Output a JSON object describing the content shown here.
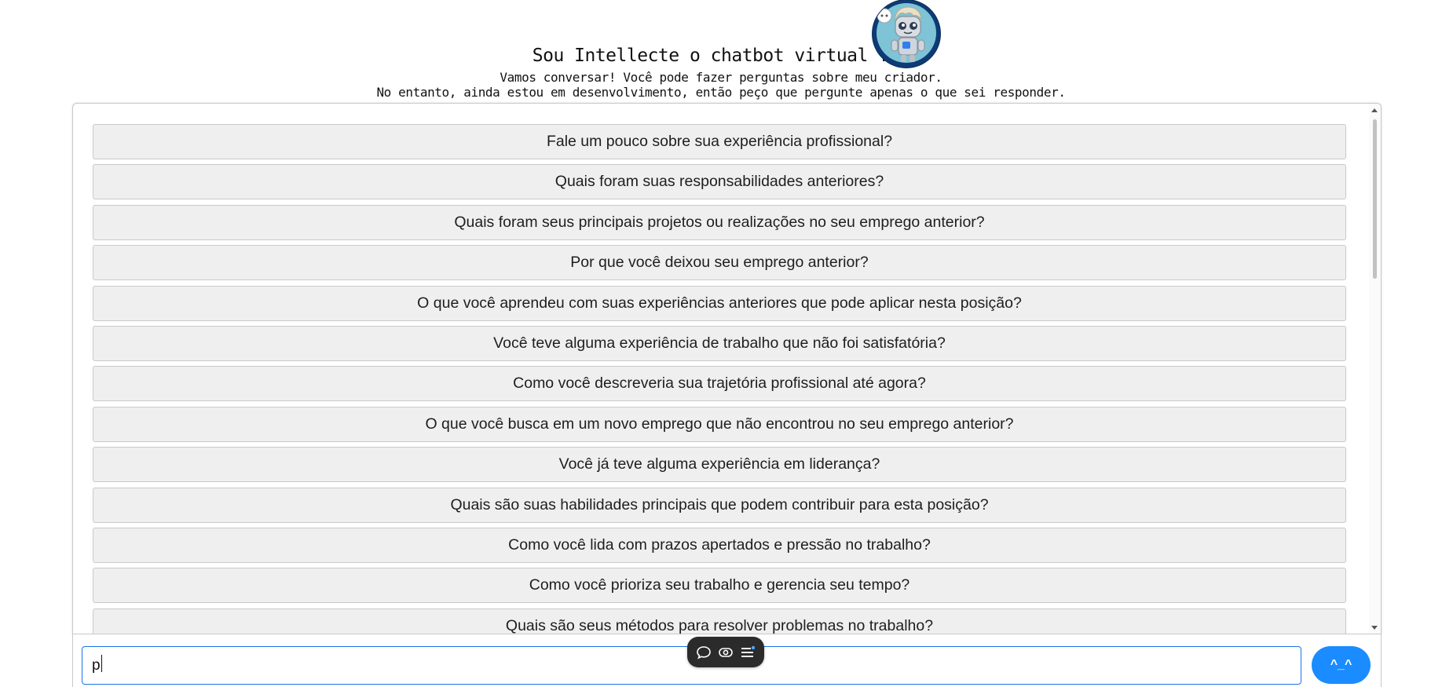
{
  "header": {
    "title": "Sou Intellecte o chatbot virtual !!!",
    "subtitle_line1": "Vamos conversar! Você pode fazer perguntas sobre meu criador.",
    "subtitle_line2": "No entanto, ainda estou em desenvolvimento, então peço que pergunte apenas o que sei responder.",
    "avatar_icon": "robot-avatar-icon"
  },
  "options": [
    "Fale um pouco sobre sua experiência profissional?",
    "Quais foram suas responsabilidades anteriores?",
    "Quais foram seus principais projetos ou realizações no seu emprego anterior?",
    "Por que você deixou seu emprego anterior?",
    "O que você aprendeu com suas experiências anteriores que pode aplicar nesta posição?",
    "Você teve alguma experiência de trabalho que não foi satisfatória?",
    "Como você descreveria sua trajetória profissional até agora?",
    "O que você busca em um novo emprego que não encontrou no seu emprego anterior?",
    "Você já teve alguma experiência em liderança?",
    "Quais são suas habilidades principais que podem contribuir para esta posição?",
    "Como você lida com prazos apertados e pressão no trabalho?",
    "Como você prioriza seu trabalho e gerencia seu tempo?",
    "Quais são seus métodos para resolver problemas no trabalho?"
  ],
  "input": {
    "value": "p"
  },
  "send_button": {
    "label": "^_^"
  },
  "toolbar": {
    "icons": [
      "chat-bubble-icon",
      "eye-toggle-icon",
      "list-menu-icon"
    ]
  },
  "colors": {
    "accent": "#1a8cff",
    "input_border": "#1a73e8",
    "option_bg": "#efefef"
  }
}
